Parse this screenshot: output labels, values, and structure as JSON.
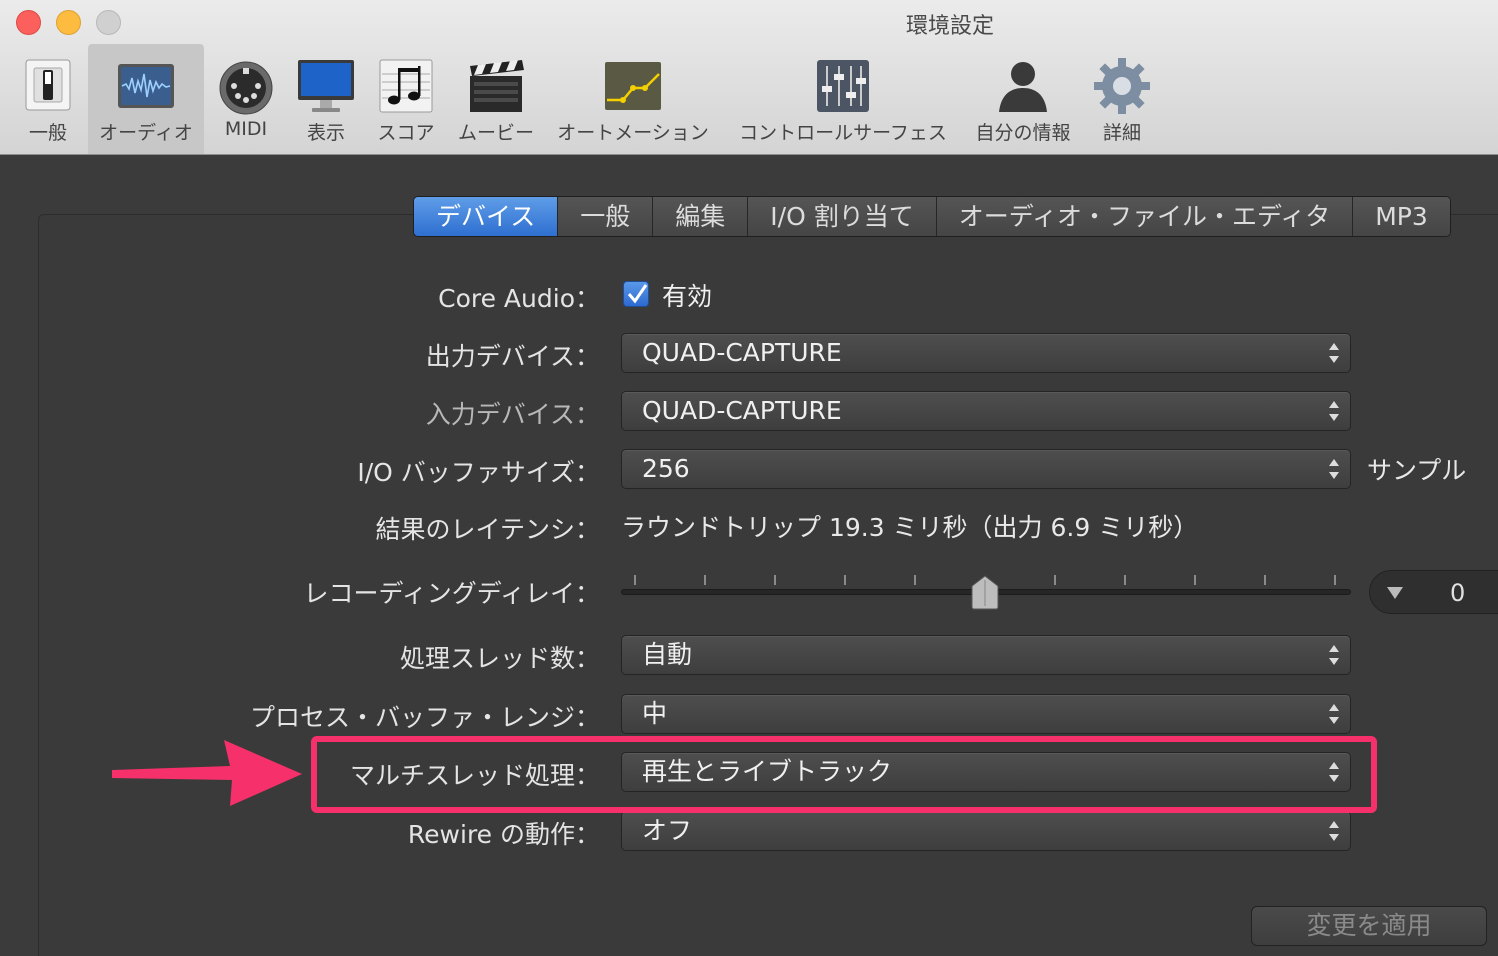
{
  "window": {
    "title": "環境設定"
  },
  "toolbar": {
    "items": [
      {
        "label": "一般",
        "icon": "switch-icon"
      },
      {
        "label": "オーディオ",
        "icon": "waveform-icon",
        "selected": true
      },
      {
        "label": "MIDI",
        "icon": "midi-connector-icon"
      },
      {
        "label": "表示",
        "icon": "monitor-icon"
      },
      {
        "label": "スコア",
        "icon": "music-notes-icon"
      },
      {
        "label": "ムービー",
        "icon": "clapperboard-icon"
      },
      {
        "label": "オートメーション",
        "icon": "automation-curve-icon"
      },
      {
        "label": "コントロールサーフェス",
        "icon": "faders-icon"
      },
      {
        "label": "自分の情報",
        "icon": "person-silhouette-icon"
      },
      {
        "label": "詳細",
        "icon": "gear-icon"
      }
    ]
  },
  "tabs": [
    "デバイス",
    "一般",
    "編集",
    "I/O 割り当て",
    "オーディオ・ファイル・エディタ",
    "MP3"
  ],
  "active_tab": "デバイス",
  "form": {
    "core_audio": {
      "label": "Core Audio：",
      "checkbox_label": "有効",
      "checked": true
    },
    "output_device": {
      "label": "出力デバイス：",
      "value": "QUAD-CAPTURE"
    },
    "input_device": {
      "label": "入力デバイス：",
      "value": "QUAD-CAPTURE"
    },
    "io_buffer": {
      "label": "I/O バッファサイズ：",
      "value": "256",
      "unit": "サンプル"
    },
    "latency": {
      "label": "結果のレイテンシ：",
      "value": "ラウンドトリップ 19.3 ミリ秒（出力 6.9 ミリ秒）"
    },
    "recording_delay": {
      "label": "レコーディングディレイ：",
      "value": "0",
      "position": 0.5
    },
    "threads": {
      "label": "処理スレッド数：",
      "value": "自動"
    },
    "process_buffer": {
      "label": "プロセス・バッファ・レンジ：",
      "value": "中"
    },
    "multithread": {
      "label": "マルチスレッド処理：",
      "value": "再生とライブトラック"
    },
    "rewire": {
      "label": "Rewire の動作：",
      "value": "オフ"
    }
  },
  "apply_button": "変更を適用",
  "colors": {
    "highlight": "#f6306a",
    "accent_blue": "#2e6fd0"
  }
}
